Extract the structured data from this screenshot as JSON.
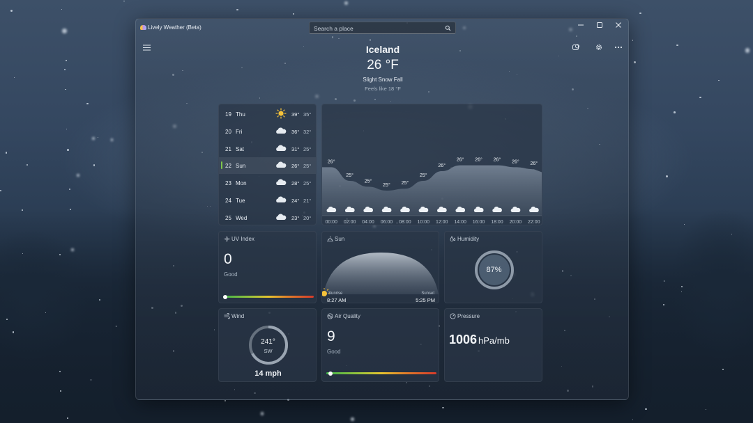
{
  "app": {
    "title": "Lively Weather (Beta)"
  },
  "search": {
    "placeholder": "Search a place"
  },
  "header": {
    "place": "Iceland",
    "temperature": "26 °F",
    "condition": "Slight Snow Fall",
    "feels_like": "Feels like 18 °F"
  },
  "forecast": {
    "days": [
      {
        "num": "19",
        "name": "Thu",
        "icon": "sun-icon",
        "hi": "39°",
        "lo": "35°"
      },
      {
        "num": "20",
        "name": "Fri",
        "icon": "cloud-icon",
        "hi": "36°",
        "lo": "32°"
      },
      {
        "num": "21",
        "name": "Sat",
        "icon": "cloud-icon",
        "hi": "31°",
        "lo": "25°"
      },
      {
        "num": "22",
        "name": "Sun",
        "icon": "cloud-icon",
        "hi": "26°",
        "lo": "25°",
        "selected": true
      },
      {
        "num": "23",
        "name": "Mon",
        "icon": "cloud-icon",
        "hi": "28°",
        "lo": "25°"
      },
      {
        "num": "24",
        "name": "Tue",
        "icon": "cloud-icon",
        "hi": "24°",
        "lo": "21°"
      },
      {
        "num": "25",
        "name": "Wed",
        "icon": "cloud-icon",
        "hi": "23°",
        "lo": "20°"
      }
    ]
  },
  "hourly": {
    "times": [
      "00:00",
      "02:00",
      "04:00",
      "06:00",
      "08:00",
      "10:00",
      "12:00",
      "14:00",
      "16:00",
      "18:00",
      "20:00",
      "22:00"
    ],
    "temps": [
      26,
      25,
      25,
      25,
      25,
      25,
      26,
      26,
      26,
      26,
      26,
      26
    ],
    "temp_labels": [
      "26°",
      "25°",
      "25°",
      "25°",
      "25°",
      "25°",
      "26°",
      "26°",
      "26°",
      "26°",
      "26°",
      "26°"
    ],
    "curve": [
      26.0,
      25.3,
      25.0,
      24.8,
      24.9,
      25.3,
      25.8,
      26.1,
      26.1,
      26.1,
      26.0,
      25.9
    ],
    "icon": "snow-cloud-icon"
  },
  "uv": {
    "label": "UV Index",
    "value": "0",
    "status": "Good",
    "level": 0.0
  },
  "sun": {
    "label": "Sun",
    "sunrise_label": "Sunrise",
    "sunrise": "8:27 AM",
    "sunset_label": "Sunset",
    "sunset": "5:25 PM"
  },
  "humidity": {
    "label": "Humidity",
    "value": "87%",
    "level": 0.87
  },
  "wind": {
    "label": "Wind",
    "direction_deg": "241°",
    "direction": "SW",
    "speed": "14 mph",
    "level": 0.67
  },
  "air_quality": {
    "label": "Air Quality",
    "value": "9",
    "status": "Good",
    "level": 0.02
  },
  "pressure": {
    "label": "Pressure",
    "value": "1006",
    "unit": "hPa/mb"
  },
  "colors": {
    "accent_green": "#7ec64a",
    "sun_yellow": "#f5c23a",
    "ring_track": "#8e9aa8"
  }
}
